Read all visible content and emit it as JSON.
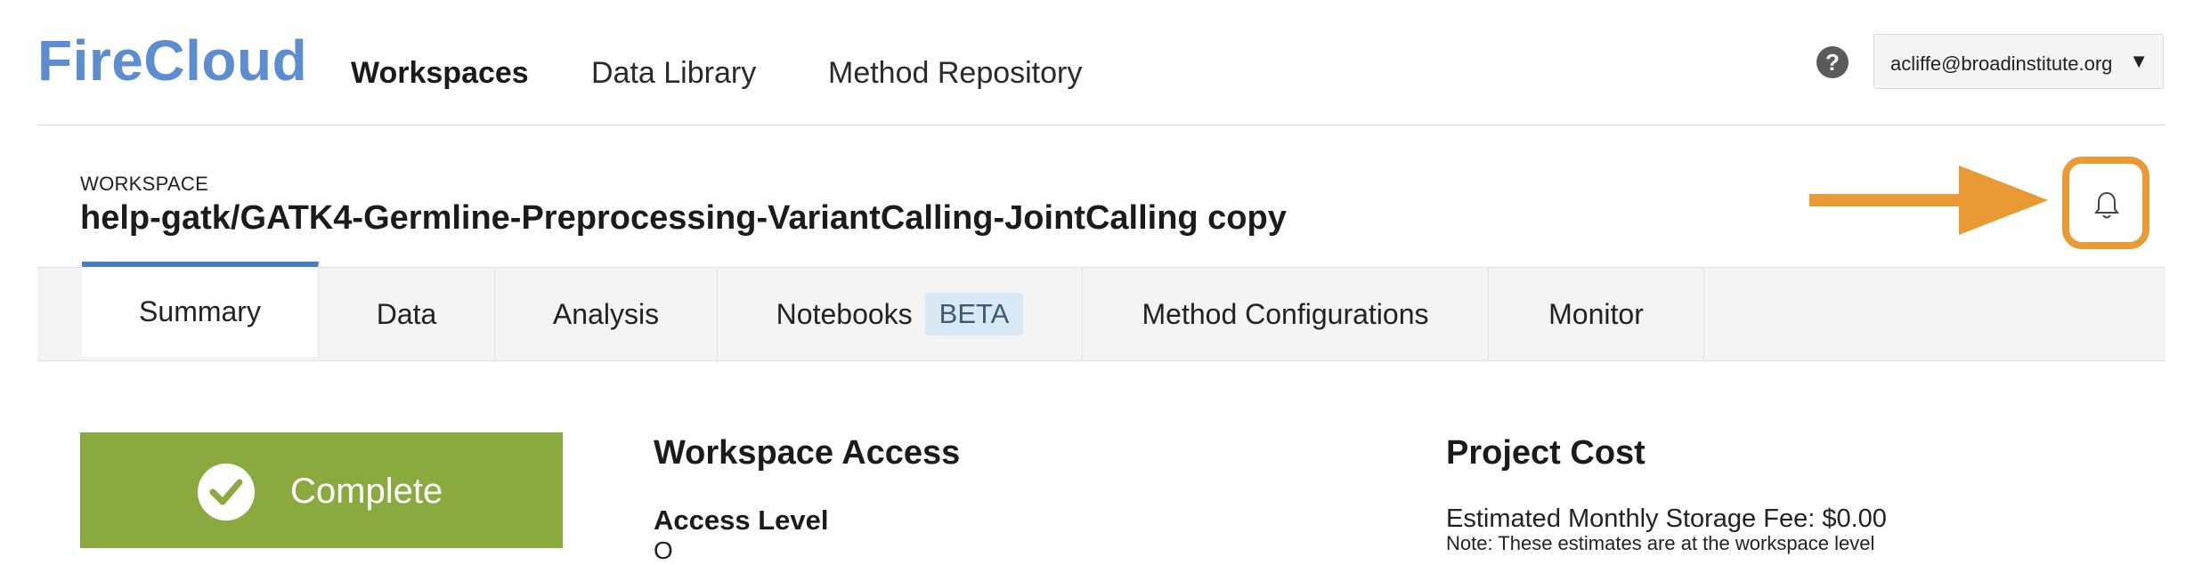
{
  "app": {
    "logo": "FireCloud"
  },
  "nav": {
    "items": [
      {
        "label": "Workspaces",
        "active": true
      },
      {
        "label": "Data Library",
        "active": false
      },
      {
        "label": "Method Repository",
        "active": false
      }
    ]
  },
  "header": {
    "help_icon": "?",
    "user_email": "acliffe@broadinstitute.org",
    "user_caret": "▼"
  },
  "workspace": {
    "label": "WORKSPACE",
    "name": "help-gatk/GATK4-Germline-Preprocessing-VariantCalling-JointCalling copy"
  },
  "annotation": {
    "arrow_color": "#e99a35",
    "highlight_target": "bell-icon"
  },
  "tabs": [
    {
      "label": "Summary",
      "active": true
    },
    {
      "label": "Data",
      "active": false
    },
    {
      "label": "Analysis",
      "active": false
    },
    {
      "label": "Notebooks",
      "badge": "BETA",
      "active": false
    },
    {
      "label": "Method Configurations",
      "active": false
    },
    {
      "label": "Monitor",
      "active": false
    }
  ],
  "summary": {
    "status": {
      "label": "Complete",
      "color": "#8aaa3f"
    },
    "access": {
      "title": "Workspace Access",
      "level_label": "Access Level",
      "level_value": "O"
    },
    "cost": {
      "title": "Project Cost",
      "storage_fee": "Estimated Monthly Storage Fee: $0.00",
      "note": "Note: These estimates are at the workspace level"
    }
  },
  "colors": {
    "brand": "#5b8dd0",
    "tab_accent": "#4a7cc5",
    "beta_bg": "#d9e8f5"
  }
}
